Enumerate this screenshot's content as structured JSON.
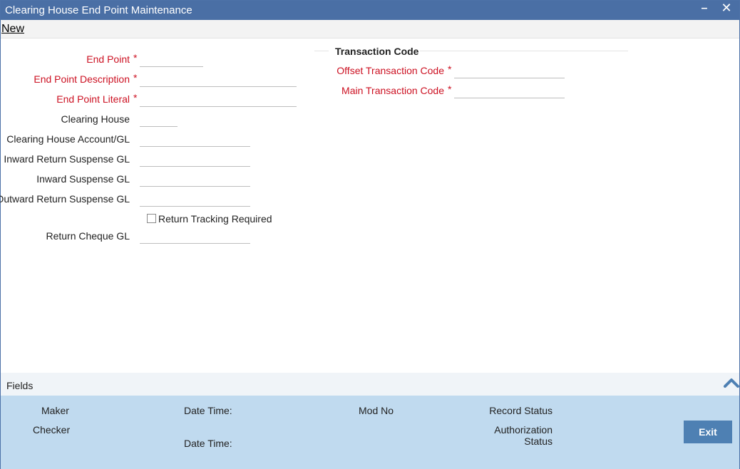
{
  "window": {
    "title": "Clearing House End Point Maintenance",
    "minimize_glyph": "–",
    "close_glyph": "✕"
  },
  "menu": {
    "new_label": "New"
  },
  "form": {
    "required_marker": "*",
    "end_point": {
      "label": "End Point",
      "value": ""
    },
    "end_point_description": {
      "label": "End Point Description",
      "value": ""
    },
    "end_point_literal": {
      "label": "End Point Literal",
      "value": ""
    },
    "clearing_house": {
      "label": "Clearing House",
      "value": ""
    },
    "clearing_house_account": {
      "label": "Clearing House Account/GL",
      "value": ""
    },
    "inward_return_suspense_gl": {
      "label": "Inward Return Suspense GL",
      "value": ""
    },
    "inward_suspense_gl": {
      "label": "Inward Suspense GL",
      "value": ""
    },
    "outward_return_suspense_gl": {
      "label": "Outward Return Suspense GL",
      "value": ""
    },
    "return_tracking_required": {
      "label": "Return Tracking Required",
      "checked": false
    },
    "return_cheque_gl": {
      "label": "Return Cheque GL",
      "value": ""
    }
  },
  "transaction_code": {
    "section_title": "Transaction Code",
    "offset_transaction_code": {
      "label": "Offset Transaction Code",
      "value": ""
    },
    "main_transaction_code": {
      "label": "Main Transaction Code",
      "value": ""
    }
  },
  "fields_bar": {
    "label": "Fields",
    "icon": "chevron-up-icon"
  },
  "footer": {
    "maker": "Maker",
    "maker_date_time": "Date Time:",
    "mod_no": "Mod No",
    "record_status": "Record Status",
    "checker": "Checker",
    "checker_date_time": "Date Time:",
    "authorization_status_line1": "Authorization",
    "authorization_status_line2": "Status",
    "exit_label": "Exit"
  },
  "colors": {
    "titlebar": "#4a6fa5",
    "required_label": "#cc1122",
    "footer": "#c0daef",
    "exit_button": "#4e80b3"
  }
}
